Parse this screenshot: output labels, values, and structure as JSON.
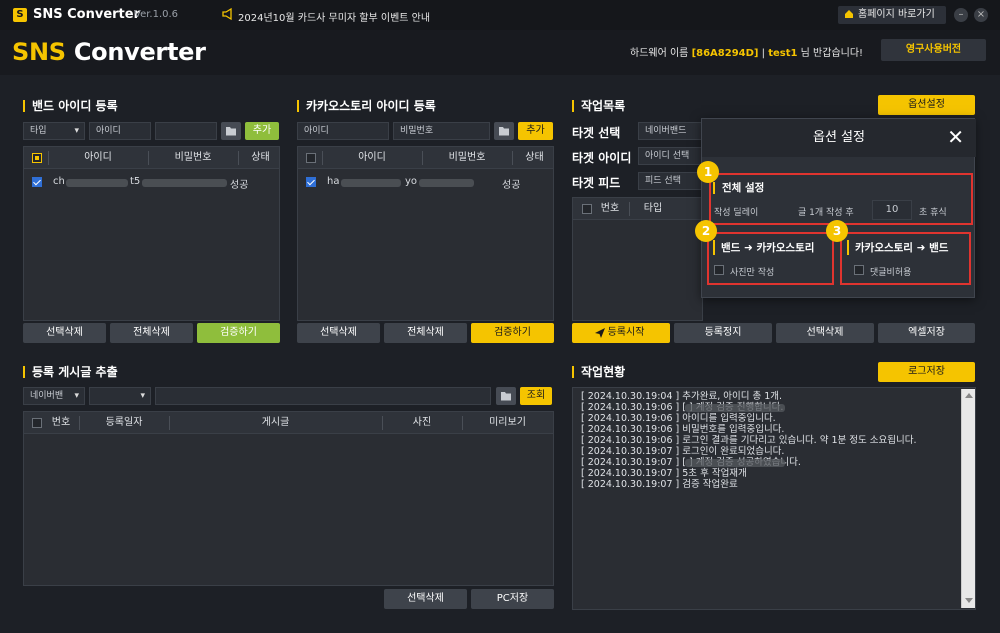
{
  "app": {
    "logo_letter": "S",
    "title": "SNS Converter",
    "version": "Ver.1.0.6",
    "notice": "2024년10월 카드사 무미자 할부 이벤트 안내",
    "home_button": "홈페이지 바로가기",
    "minimize": "–",
    "close": "×"
  },
  "header": {
    "brand_y": "SNS",
    "brand_w": " Converter",
    "hw_prefix": "하드웨어 이름 ",
    "hw_id": "[86A8294D]",
    "sep": " | ",
    "user": "test1",
    "greeting": " 님 반갑습니다!",
    "perm_button": "영구사용버전"
  },
  "band": {
    "title": "밴드 아이디 등록",
    "type_select": "타입",
    "id_placeholder": "아이디",
    "add_button": "추가",
    "columns": [
      "아이디",
      "비밀번호",
      "상태"
    ],
    "rows": [
      {
        "id": "ch",
        "pw": "t5",
        "status": "성공"
      }
    ],
    "btn_delete_selected": "선택삭제",
    "btn_delete_all": "전체삭제",
    "btn_verify": "검증하기"
  },
  "kakao": {
    "title": "카카오스토리 아이디 등록",
    "id_placeholder": "아이디",
    "pw_placeholder": "비밀번호",
    "add_button": "추가",
    "columns": [
      "아이디",
      "비밀번호",
      "상태"
    ],
    "rows": [
      {
        "id": "ha",
        "pw": "yo",
        "status": "성공"
      }
    ],
    "btn_delete_selected": "선택삭제",
    "btn_delete_all": "전체삭제",
    "btn_verify": "검증하기"
  },
  "jobs": {
    "title": "작업목록",
    "options_button": "옵션설정",
    "target_select_label": "타겟 선택",
    "target_select_value": "네이버밴드",
    "target_id_label": "타겟 아이디",
    "target_id_value": "아이디 선택",
    "target_feed_label": "타겟 피드",
    "target_feed_value": "피드 선택",
    "columns": [
      "번호",
      "타입"
    ],
    "btn_start": "등록시작",
    "btn_stop": "등록정지",
    "btn_delete_selected": "선택삭제",
    "btn_excel": "엑셀저장"
  },
  "extract": {
    "title": "등록 게시글 추출",
    "site_select": "네이버밴",
    "search_button": "조회",
    "columns": [
      "번호",
      "등록일자",
      "게시글",
      "사진",
      "미리보기"
    ],
    "btn_delete_selected": "선택삭제",
    "btn_pc_save": "PC저장"
  },
  "status": {
    "title": "작업현황",
    "log_save_button": "로그저장",
    "lines": [
      "[ 2024.10.30.19:04 ] 추가완료, 아이디 총 1개.",
      "[ 2024.10.30.19:06 ] [                         ] 계정 검증 진행합니다.",
      "[ 2024.10.30.19:06 ] 아이디를 입력중입니다.",
      "[ 2024.10.30.19:06 ] 비밀번호를 입력중입니다.",
      "[ 2024.10.30.19:06 ] 로그인 결과를 기다리고 있습니다. 약 1분 정도 소요됩니다.",
      "[ 2024.10.30.19:07 ] 로그인이 완료되었습니다.",
      "[ 2024.10.30.19:07 ] [                         ] 계정 검증 성공하였습니다.",
      "[ 2024.10.30.19:07 ] 5초 후 작업재개",
      "[ 2024.10.30.19:07 ] 검증 작업완료"
    ]
  },
  "modal": {
    "title": "옵션 설정",
    "close": "✕",
    "badges": [
      "1",
      "2",
      "3"
    ],
    "general_title": "전체 설정",
    "delay_label": "작성 딜레이",
    "per_post_label": "글 1개 작성 후",
    "delay_value": "10",
    "rest_label": "초 휴식",
    "band_to_kakao_a": "밴드",
    "band_to_kakao_b": "카카오스토리",
    "photo_only": "사진만 작성",
    "kakao_to_band_a": "카카오스토리",
    "kakao_to_band_b": "밴드",
    "comment_allow": "댓글비허용",
    "arrow": "➜"
  },
  "colors": {
    "accent": "#f5c400",
    "verify_green": "#8fbe3c",
    "highlight_red": "#e0342f",
    "check_blue": "#2f6fd6"
  }
}
